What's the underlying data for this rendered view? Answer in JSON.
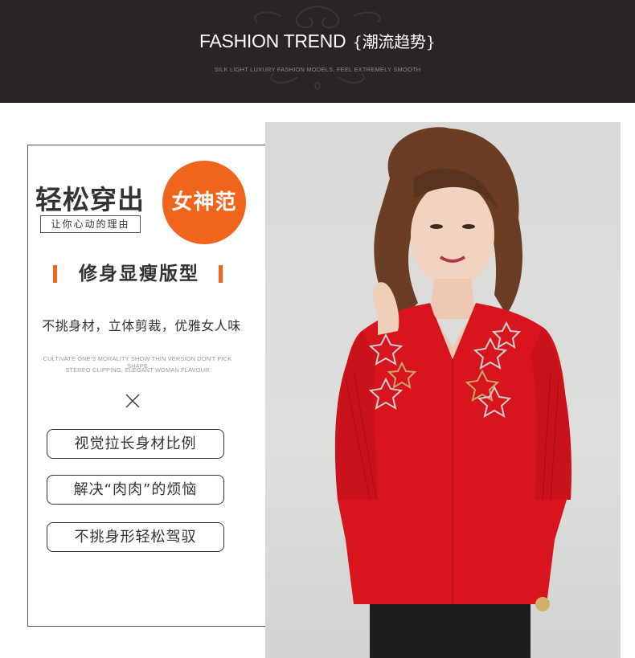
{
  "banner": {
    "title": "FASHION TREND",
    "title_cn": "{潮流趋势}",
    "subtitle": "SILK LIGHT LUXURY FASHION MODELS, FEEL EXTREMELY SMOOTH"
  },
  "promo": {
    "headline": "轻松穿出",
    "badge": "女神范",
    "tagline": "让你心动的理由",
    "section_title": "修身显瘦版型",
    "description": "不挑身材，立体剪裁，优雅女人味",
    "english_line1": "CULTIVATE ONE'S MORALITY SHOW THIN VERSION DON'T PICK SHAPE",
    "english_line2": "STEREO CLIPPING, ELEGANT WOMAN FLAVOUR",
    "features": [
      "视觉拉长身材比例",
      "解决“肉肉”的烦恼",
      "不挑身形轻松驾驭"
    ]
  },
  "colors": {
    "banner_bg": "#2b2425",
    "accent": "#f0651b",
    "blouse": "#d8141c"
  },
  "photo": {
    "subject": "model-wearing-red-blouse"
  }
}
